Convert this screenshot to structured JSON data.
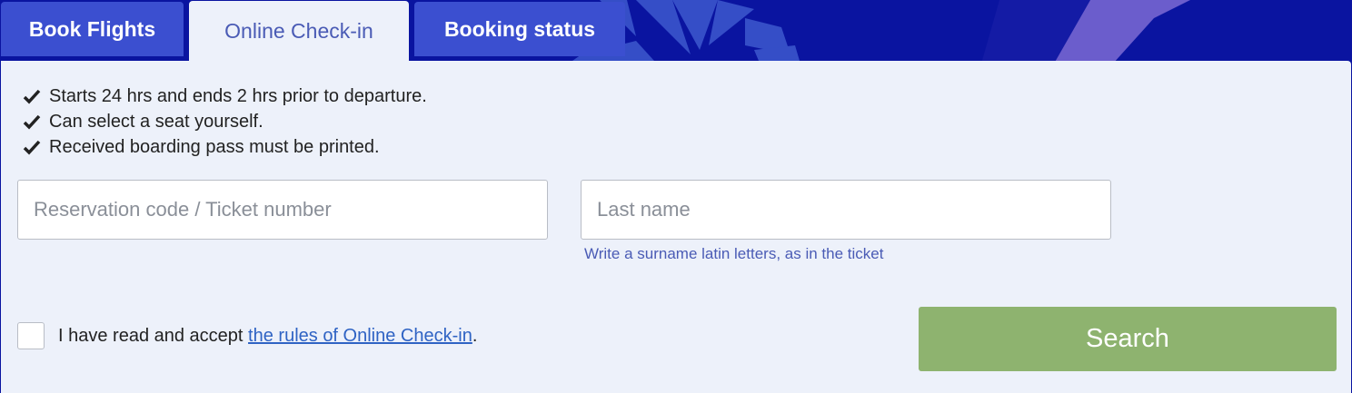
{
  "tabs": [
    {
      "label": "Book Flights",
      "active": false
    },
    {
      "label": "Online Check-in",
      "active": true
    },
    {
      "label": "Booking status",
      "active": false
    }
  ],
  "features": [
    {
      "text": "Starts 24 hrs and ends 2 hrs prior to departure.",
      "icon": "check-icon"
    },
    {
      "text": "Can select a seat yourself.",
      "icon": "check-icon"
    },
    {
      "text": "Received boarding pass must be printed.",
      "icon": "check-icon"
    }
  ],
  "form": {
    "reservation": {
      "placeholder": "Reservation code / Ticket number",
      "value": ""
    },
    "last_name": {
      "placeholder": "Last name",
      "value": ""
    },
    "last_name_hint": "Write a surname latin letters, as in the ticket"
  },
  "consent": {
    "prefix": "I have read and accept ",
    "link_text": "the rules of Online Check-in",
    "suffix": ".",
    "checked": false
  },
  "search_label": "Search",
  "colors": {
    "brand_blue": "#0a14a0",
    "tab_blue": "#3b4fd0",
    "panel_bg": "#edf1fa",
    "accent_text": "#4a5bb5",
    "link": "#2f63c4",
    "search_button": "#8eb36f"
  }
}
